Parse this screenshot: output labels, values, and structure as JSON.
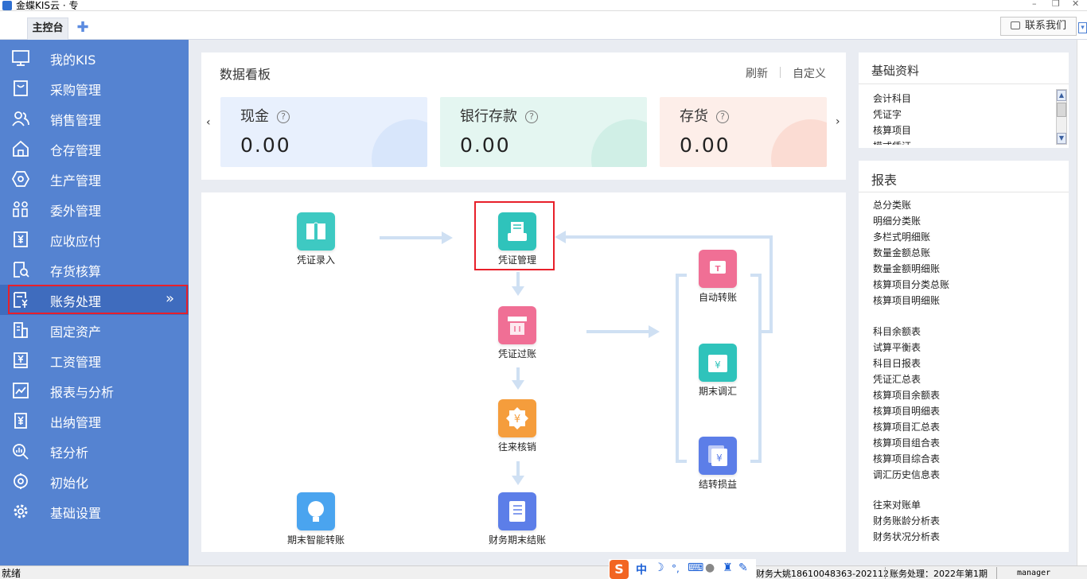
{
  "window": {
    "title": "金蝶KIS云 · 专"
  },
  "tabs": {
    "main": "主控台",
    "add_icon": "plus-icon"
  },
  "header": {
    "contact_label": "联系我们"
  },
  "sidebar": {
    "items": [
      {
        "label": "我的KIS",
        "icon": "monitor-icon"
      },
      {
        "label": "采购管理",
        "icon": "shopping-bag-icon"
      },
      {
        "label": "销售管理",
        "icon": "users-icon"
      },
      {
        "label": "仓存管理",
        "icon": "warehouse-icon"
      },
      {
        "label": "生产管理",
        "icon": "hexagon-gear-icon"
      },
      {
        "label": "委外管理",
        "icon": "outsource-icon"
      },
      {
        "label": "应收应付",
        "icon": "yen-receipt-icon"
      },
      {
        "label": "存货核算",
        "icon": "inventory-search-icon"
      },
      {
        "label": "账务处理",
        "icon": "ledger-yen-icon",
        "active": true
      },
      {
        "label": "固定资产",
        "icon": "building-icon"
      },
      {
        "label": "工资管理",
        "icon": "salary-icon"
      },
      {
        "label": "报表与分析",
        "icon": "line-chart-icon"
      },
      {
        "label": "出纳管理",
        "icon": "cashier-icon"
      },
      {
        "label": "轻分析",
        "icon": "analysis-icon"
      },
      {
        "label": "初始化",
        "icon": "init-icon"
      },
      {
        "label": "基础设置",
        "icon": "settings-icon"
      }
    ]
  },
  "dashboard": {
    "title": "数据看板",
    "refresh": "刷新",
    "customize": "自定义",
    "cards": [
      {
        "label": "现金",
        "value": "0.00",
        "bg": "#e8f0fd",
        "accent": "#d8e6fb"
      },
      {
        "label": "银行存款",
        "value": "0.00",
        "bg": "#e4f6f1",
        "accent": "#d0efe6"
      },
      {
        "label": "存货",
        "value": "0.00",
        "bg": "#fdeee9",
        "accent": "#fbdcd3"
      }
    ]
  },
  "flow": {
    "nodes": {
      "voucher_entry": {
        "label": "凭证录入",
        "color": "#3ec9c2"
      },
      "voucher_manage": {
        "label": "凭证管理",
        "color": "#2fc3bb"
      },
      "voucher_post": {
        "label": "凭证过账",
        "color": "#f06f95"
      },
      "writeoff": {
        "label": "往来核销",
        "color": "#f59d3c"
      },
      "period_close": {
        "label": "财务期末结账",
        "color": "#5c7ee8"
      },
      "smart_transfer": {
        "label": "期末智能转账",
        "color": "#4aa4ef"
      },
      "auto_transfer": {
        "label": "自动转账",
        "color": "#f06f95"
      },
      "period_adjust": {
        "label": "期末调汇",
        "color": "#2fc3bb"
      },
      "pl_transfer": {
        "label": "结转损益",
        "color": "#5c7ee8"
      }
    }
  },
  "basics": {
    "title": "基础资料",
    "items": [
      "会计科目",
      "凭证字",
      "核算项目",
      "模式凭证"
    ]
  },
  "reports": {
    "title": "报表",
    "groups": [
      [
        "总分类账",
        "明细分类账",
        "多栏式明细账",
        "数量金额总账",
        "数量金额明细账",
        "核算项目分类总账",
        "核算项目明细账"
      ],
      [
        "科目余额表",
        "试算平衡表",
        "科目日报表",
        "凭证汇总表",
        "核算项目余额表",
        "核算项目明细表",
        "核算项目汇总表",
        "核算项目组合表",
        "核算项目综合表",
        "调汇历史信息表"
      ],
      [
        "往来对账单",
        "财务账龄分析表",
        "财务状况分析表"
      ]
    ]
  },
  "status": {
    "ready": "就绪",
    "ime_cn": "中",
    "company": "财务大姚18610048363-202112",
    "period": "账务处理：2022年第1期",
    "user": "manager"
  }
}
